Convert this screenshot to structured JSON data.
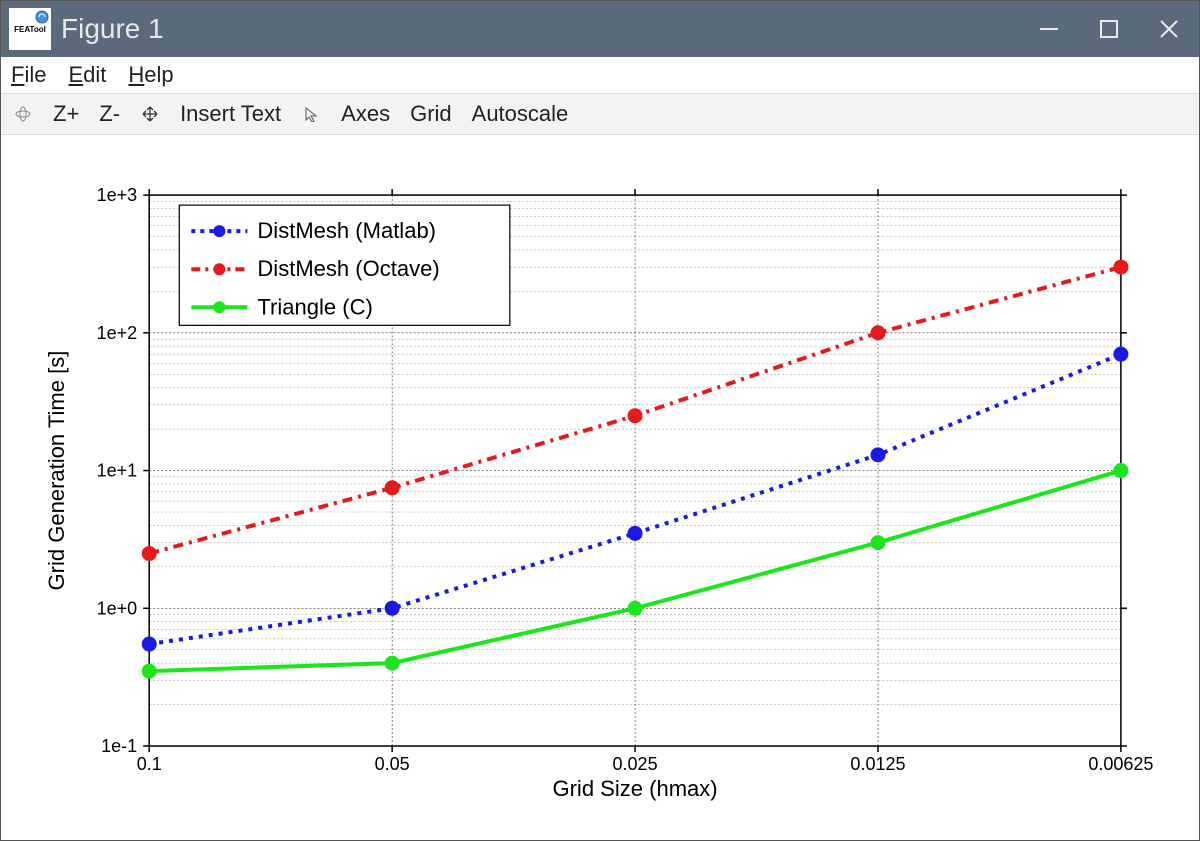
{
  "window": {
    "title": "Figure 1",
    "logo_text": "FEATool"
  },
  "menubar": {
    "file": "File",
    "edit": "Edit",
    "help": "Help"
  },
  "toolbar": {
    "zoom_in": "Z+",
    "zoom_out": "Z-",
    "insert_text": "Insert Text",
    "axes": "Axes",
    "grid": "Grid",
    "autoscale": "Autoscale"
  },
  "chart_data": {
    "type": "line",
    "title": "",
    "xlabel": "Grid Size (hmax)",
    "ylabel": "Grid Generation Time [s]",
    "x_scale": "log_reversed",
    "y_scale": "log",
    "x_ticks": [
      0.1,
      0.05,
      0.025,
      0.0125,
      0.00625
    ],
    "y_ticks_exp": [
      -1,
      0,
      1,
      2,
      3
    ],
    "y_tick_labels": [
      "1e-1",
      "1e+0",
      "1e+1",
      "1e+2",
      "1e+3"
    ],
    "legend_position": "upper left",
    "series": [
      {
        "name": "DistMesh (Matlab)",
        "color": "#1a1ae6",
        "style": "dotted",
        "marker": "circle",
        "x": [
          0.1,
          0.05,
          0.025,
          0.0125,
          0.00625
        ],
        "y": [
          0.55,
          1.0,
          3.5,
          13.0,
          70.0
        ]
      },
      {
        "name": "DistMesh (Octave)",
        "color": "#e61a1a",
        "style": "dashdot",
        "marker": "circle",
        "x": [
          0.1,
          0.05,
          0.025,
          0.0125,
          0.00625
        ],
        "y": [
          2.5,
          7.5,
          25.0,
          100.0,
          300.0
        ]
      },
      {
        "name": "Triangle (C)",
        "color": "#1ae61a",
        "style": "solid",
        "marker": "circle",
        "x": [
          0.1,
          0.05,
          0.025,
          0.0125,
          0.00625
        ],
        "y": [
          0.35,
          0.4,
          1.0,
          3.0,
          10.0
        ]
      }
    ]
  }
}
